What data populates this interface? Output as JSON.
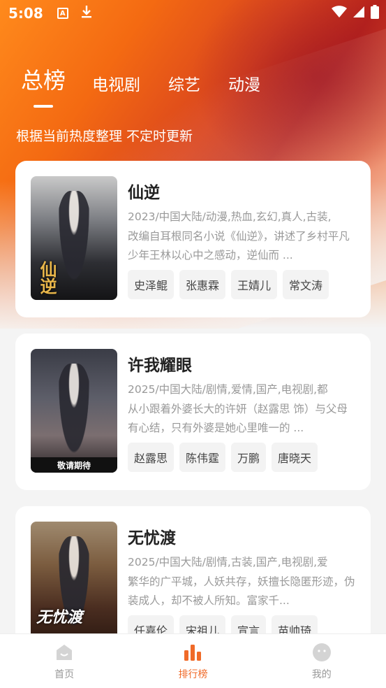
{
  "status_bar": {
    "time": "5:08",
    "icons": [
      "a-notification-icon",
      "download-icon",
      "wifi-icon",
      "signal-icon",
      "battery-icon"
    ]
  },
  "tabs": [
    {
      "label": "总榜",
      "active": true
    },
    {
      "label": "电视剧",
      "active": false
    },
    {
      "label": "综艺",
      "active": false
    },
    {
      "label": "动漫",
      "active": false
    }
  ],
  "subtitle": "根据当前热度整理 不定时更新",
  "items": [
    {
      "title": "仙逆",
      "meta": "2023/中国大陆/动漫,热血,玄幻,真人,古装,",
      "desc": "改编自耳根同名小说《仙逆》，讲述了乡村平凡少年王林以心中之感动，逆仙而 ...",
      "cast": [
        "史泽鲲",
        "张惠霖",
        "王婧儿",
        "常文涛"
      ],
      "poster_text": "仙逆"
    },
    {
      "title": "许我耀眼",
      "meta": "2025/中国大陆/剧情,爱情,国产,电视剧,都",
      "desc": "从小跟着外婆长大的许妍（赵露思 饰）与父母有心结，只有外婆是她心里唯一的 ...",
      "cast": [
        "赵露思",
        "陈伟霆",
        "万鹏",
        "唐晓天"
      ],
      "poster_text": "敬请期待"
    },
    {
      "title": "无忧渡",
      "meta": "2025/中国大陆/剧情,古装,国产,电视剧,爱",
      "desc": "繁华的广平城，人妖共存，妖擅长隐匿形迹，伪装成人，却不被人所知。富家千...",
      "cast": [
        "任嘉伦",
        "宋祖儿",
        "宣言",
        "苗帅琦"
      ],
      "poster_text": "无忧渡"
    }
  ],
  "bottom_nav": [
    {
      "label": "首页",
      "icon": "home-icon",
      "active": false
    },
    {
      "label": "排行榜",
      "icon": "ranking-icon",
      "active": true
    },
    {
      "label": "我的",
      "icon": "profile-icon",
      "active": false
    }
  ],
  "colors": {
    "accent": "#f06a28",
    "hero_start": "#ff8a1c",
    "hero_mid": "#b8231b"
  }
}
